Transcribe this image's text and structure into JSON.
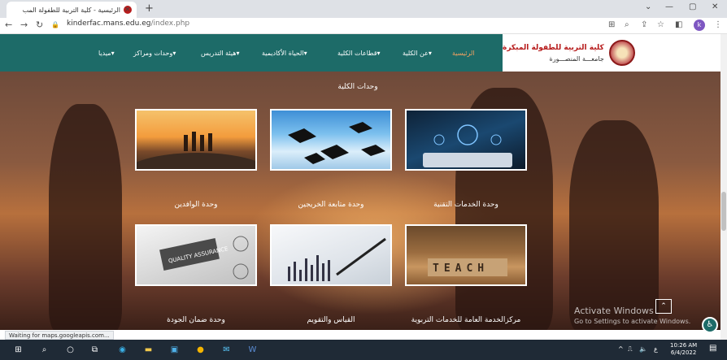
{
  "browser": {
    "tab_title": "الرئيسية - كلية التربية للطفولة المب",
    "tab_close": "×",
    "new_tab": "+",
    "url_host": "kinderfac.mans.edu.eg",
    "url_path": "/index.php",
    "profile_letter": "k",
    "controls": {
      "chevron": "⌄",
      "minimize": "—",
      "restore": "▢",
      "close": "✕"
    }
  },
  "site": {
    "college_name": "كلية التربية للطفولة المبكرة",
    "university_name": "جامعـــة المنصـــورة",
    "menu": [
      {
        "label": "الرئيسية",
        "active": true
      },
      {
        "label": "عن الكلية▾",
        "active": false
      },
      {
        "label": "قطاعات الكلية▾",
        "active": false
      },
      {
        "label": "الحياة الأكاديمية▾",
        "active": false
      },
      {
        "label": "هيئة التدريس▾",
        "active": false
      },
      {
        "label": "وحدات ومراكز▾",
        "active": false
      },
      {
        "label": "ميديا▾",
        "active": false
      }
    ]
  },
  "main": {
    "section_title": "وحدات الكلية",
    "cards": [
      {
        "caption": "وحدة الوافدين",
        "image": "horizon-figures"
      },
      {
        "caption": "وحدة متابعة الخريجين",
        "image": "graduation-caps"
      },
      {
        "caption": "وحدة الخدمات التقنية",
        "image": "e-learning-tablet"
      },
      {
        "caption": "وحدة ضمان الجودة",
        "image": "quality-assurance"
      },
      {
        "caption": "القياس والتقويم",
        "image": "charts-pen"
      },
      {
        "caption": "مركزالخدمة العامة للخدمات التربوية",
        "image": "teach-blocks"
      }
    ],
    "teach_letters": "TEACH",
    "qa_text": "QUALITY ASSURANCE"
  },
  "watermark": {
    "line1": "Activate Windows",
    "line2": "Go to Settings to activate Windows."
  },
  "status_text": "Waiting for maps.googleapis.com...",
  "taskbar": {
    "time": "10:26 AM",
    "date": "6/4/2022",
    "lang": "ع"
  },
  "colors": {
    "brand_teal": "#1d6b68",
    "active_menu": "#f4a261",
    "college_red": "#b71c1c"
  }
}
